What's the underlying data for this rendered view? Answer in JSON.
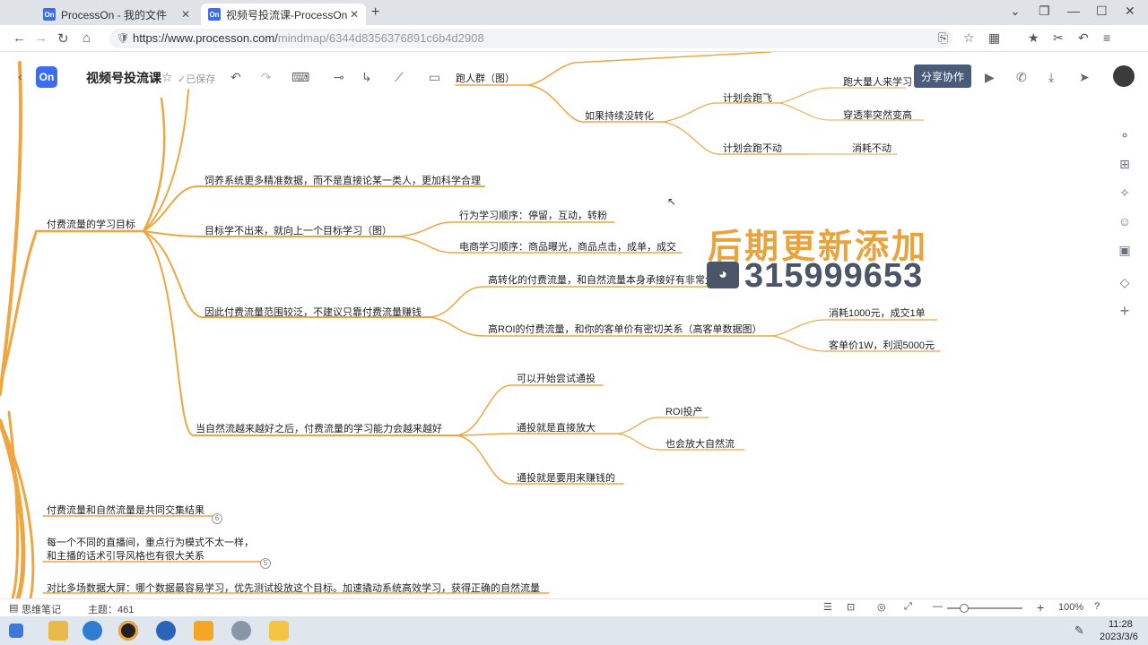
{
  "browser": {
    "tabs": [
      {
        "favicon": "On",
        "title": "ProcessOn - 我的文件"
      },
      {
        "favicon": "On",
        "title": "视频号投流课-ProcessOn"
      }
    ],
    "new_tab_label": "+",
    "url_main": "https://www.processon.com/",
    "url_rest": "mindmap/6344d8356376891c6b4d2908"
  },
  "app": {
    "logo": "On",
    "title": "视频号投流课",
    "saved": "已保存",
    "share_button": "分享协作"
  },
  "mindmap": {
    "top_node": "跑人群（图）",
    "no_convert": "如果持续没转化",
    "plan_fly": "计划会跑飞",
    "big_audience": "跑大量人来学习",
    "penetration": "穿透率突然变高",
    "plan_stuck": "计划会跑不动",
    "no_spend": "消耗不动",
    "learn_goal": "付费流量的学习目标",
    "feed_system": "饲养系统更多精准数据，而不是直接论某一类人，更加科学合理",
    "goal_learn": "目标学不出来，就向上一个目标学习（图）",
    "behavior_order": "行为学习顺序：停留，互动，转粉",
    "ecom_order": "电商学习顺序：商品曝光，商品点击，成单，成交",
    "wide_range": "因此付费流量范围较泛，不建议只靠付费流量赚钱",
    "high_convert": "高转化的付费流量，和自然流量本身承接好有非常大关系",
    "high_roi": "高ROI的付费流量，和你的客单价有密切关系（高客单数据图）",
    "spend_1000": "消耗1000元，成交1单",
    "price_1w": "客单价1W，利润5000元",
    "natural_better": "当自然流越来越好之后，付费流量的学习能力会越来越好",
    "can_try": "可以开始尝试通投",
    "direct_scale": "通投就是直接放大",
    "roi_output": "ROI投产",
    "amplify": "也会放大自然流",
    "to_earn": "通投就是要用来赚钱的",
    "result_node": "付费流量和自然流量是共同交集结果",
    "different_room_1": "每一个不同的直播间，重点行为模式不太一样，",
    "different_room_2": "和主播的话术引导风格也有很大关系",
    "compare_node": "对比多场数据大屏：哪个数据最容易学习，优先测试投放这个目标。加速撬动系统高效学习，获得正确的自然流量"
  },
  "watermark": {
    "line1": "后期更新添加",
    "line2": "315999653"
  },
  "statusbar": {
    "mode": "思维笔记",
    "topic_count": "主题：461",
    "zoom": "100%"
  },
  "taskbar": {
    "time": "11:28",
    "date": "2023/3/6"
  },
  "colors": {
    "branch": "#f0a640",
    "accent": "#3a6df0"
  }
}
